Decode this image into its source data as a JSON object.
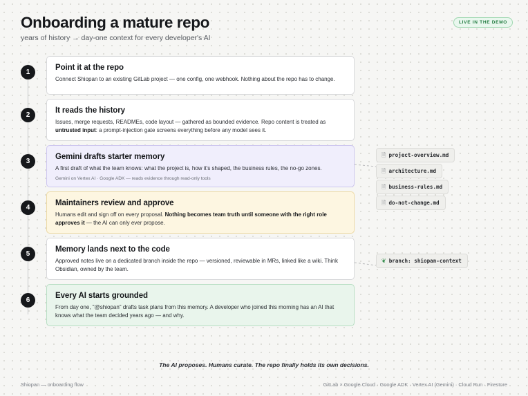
{
  "header": {
    "title": "Onboarding a mature repo",
    "subtitle": "years of history → day-one context for every developer's AI",
    "badge": "LIVE IN THE DEMO"
  },
  "steps": [
    {
      "number": "1",
      "title": "Point it at the repo",
      "body": "Connect Shiopan to an existing GitLab project — one config, one webhook. Nothing about the repo has to change."
    },
    {
      "number": "2",
      "title": "It reads the history",
      "body_a": "Issues, merge requests, READMEs, code layout — gathered as bounded evidence. Repo content is treated as ",
      "body_bold": "untrusted input",
      "body_b": ": a prompt-injection gate screens everything before any model sees it."
    },
    {
      "number": "3",
      "title": "Gemini drafts starter memory",
      "body": "A first draft of what the team knows: what the project is, how it's shaped, the business rules, the no-go zones.",
      "note": "Gemini on Vertex AI · Google ADK — reads evidence through read-only tools"
    },
    {
      "number": "4",
      "title": "Maintainers review and approve",
      "body_a": "Humans edit and sign off on every proposal. ",
      "body_bold": "Nothing becomes team truth until someone with the right role approves it",
      "body_b": " — the AI can only ever propose."
    },
    {
      "number": "5",
      "title": "Memory lands next to the code",
      "body": "Approved notes live on a dedicated branch inside the repo — versioned, reviewable in MRs, linked like a wiki. Think Obsidian, owned by the team."
    },
    {
      "number": "6",
      "title": "Every AI starts grounded",
      "body": "From day one, \"@shiopan\" drafts task plans from this memory. A developer who joined this morning has an AI that knows what the team decided years ago — and why."
    }
  ],
  "memory_files": [
    {
      "icon": "document-icon",
      "name": "project-overview.md"
    },
    {
      "icon": "document-icon",
      "name": "architecture.md"
    },
    {
      "icon": "document-icon",
      "name": "business-rules.md"
    },
    {
      "icon": "document-icon",
      "name": "do-not-change.md"
    }
  ],
  "branch": {
    "icon": "leaf-icon",
    "label": "branch: shiopan-context"
  },
  "tagline": "The AI proposes. Humans curate. The repo finally holds its own decisions.",
  "footer": {
    "left": "Shiopan — onboarding flow",
    "right": "GitLab × Google Cloud · Google ADK · Vertex AI (Gemini) · Cloud Run · Firestore"
  },
  "colors": {
    "badge_green": "#1f7a3e",
    "step3_purple": "#f0eefc",
    "step4_yellow": "#fdf6e1",
    "step6_green": "#e9f5ec"
  }
}
